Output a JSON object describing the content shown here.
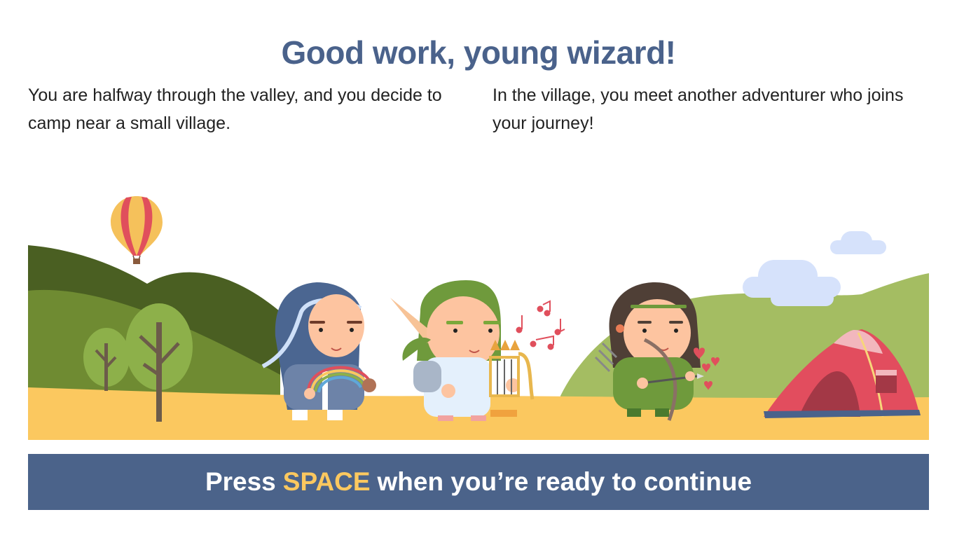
{
  "heading": "Good work, young wizard!",
  "story": {
    "left": "You are halfway through the valley, and you decide to camp near a small village.",
    "right": "In the village, you meet another adventurer who joins your journey!"
  },
  "prompt": {
    "before": "Press",
    "key": "SPACE",
    "after": "when you’re ready to continue"
  },
  "colors": {
    "heading": "#4a628b",
    "bar": "#4b638a",
    "key_highlight": "#fbc85f",
    "ground": "#fbc85f",
    "tent": "#e24d5e"
  },
  "scene": {
    "icons": [
      "hot-air-balloon",
      "trees",
      "wizard-with-rainbow",
      "elf-with-harp",
      "archer-with-bow",
      "tent",
      "clouds",
      "music-notes",
      "hearts"
    ]
  }
}
